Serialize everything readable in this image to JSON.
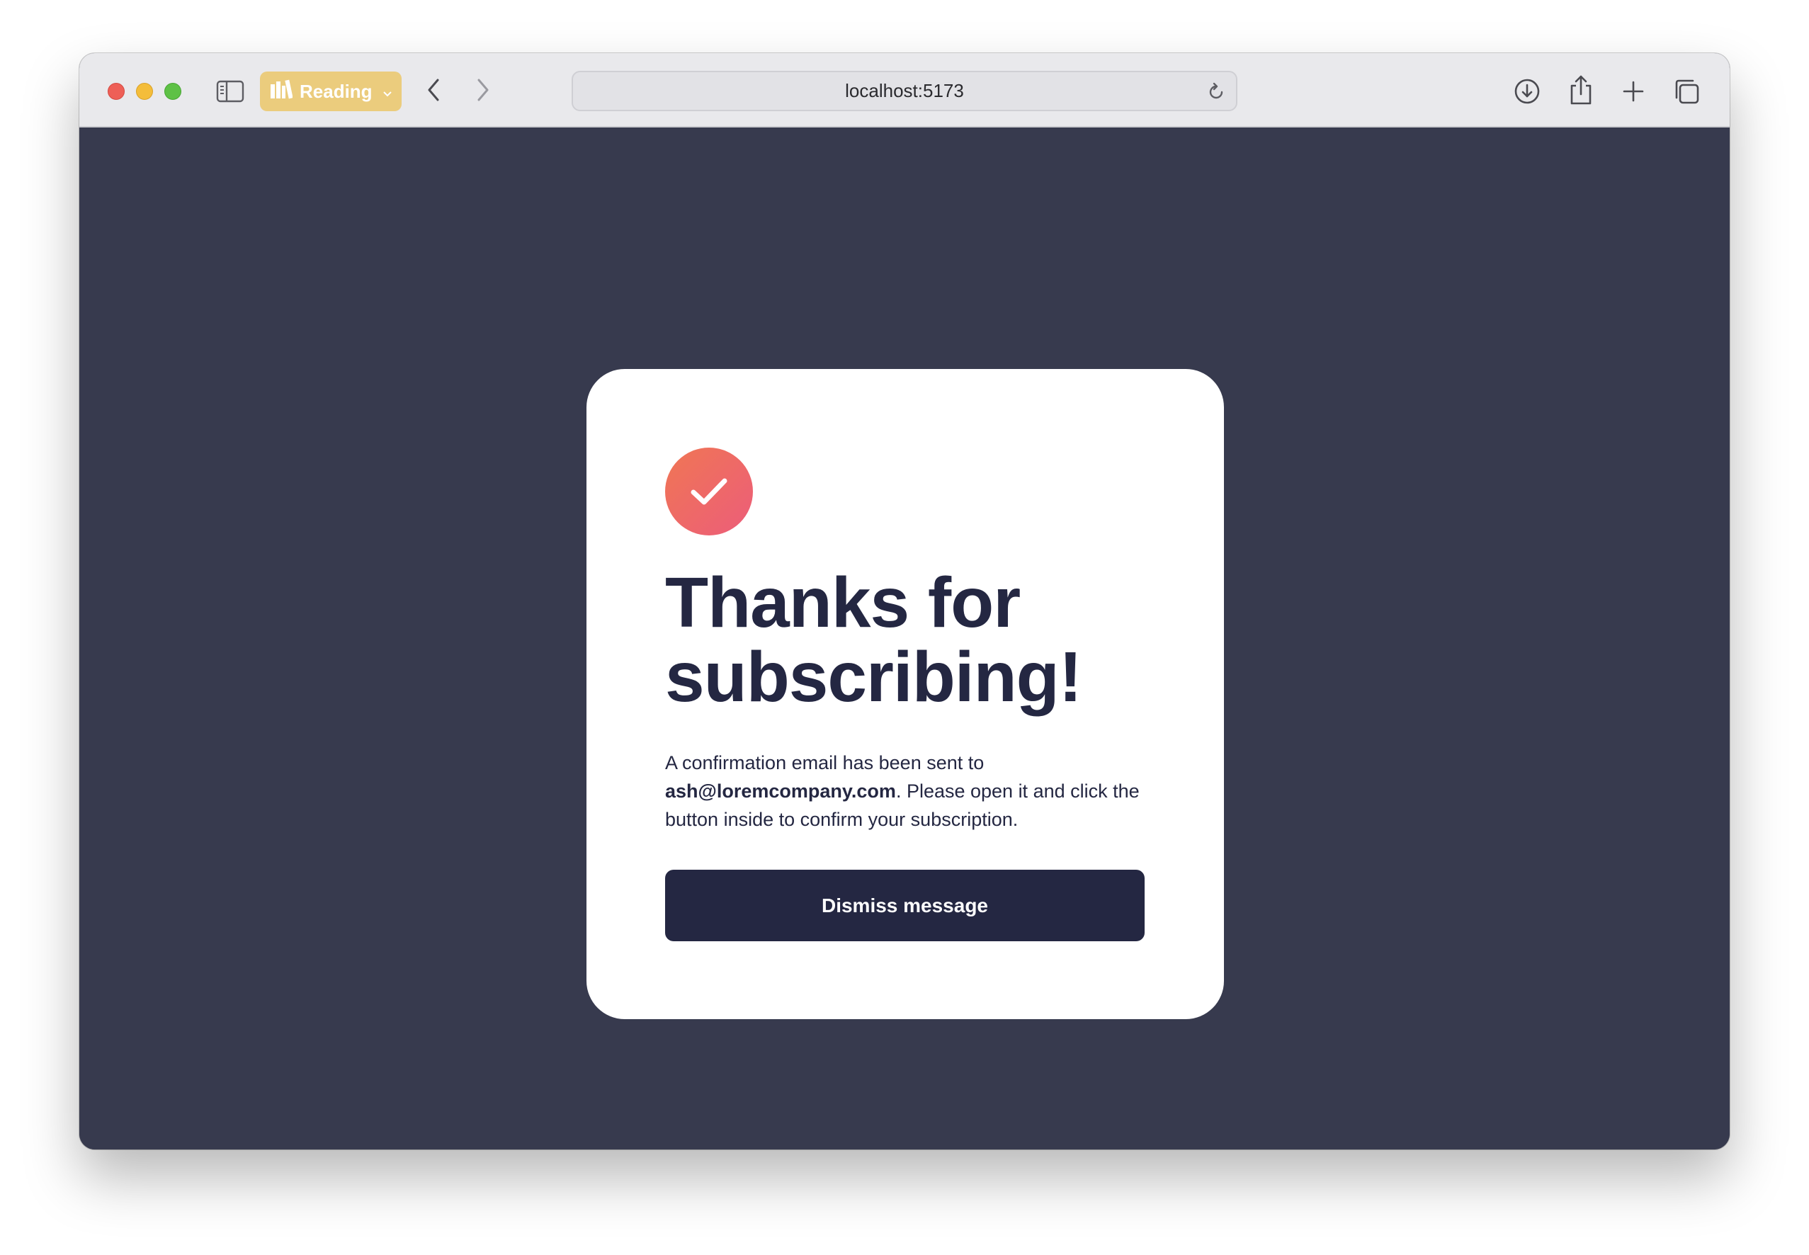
{
  "browser": {
    "reading_label": "Reading",
    "url": "localhost:5173",
    "colors": {
      "titlebar": "#e9e9ec",
      "reading_button": "#ebcc7d"
    },
    "icons": {
      "sidebar": "sidebar-icon",
      "reading": "reading-list-icon",
      "back": "chevron-left-icon",
      "forward": "chevron-right-icon",
      "reload": "reload-icon",
      "download": "download-icon",
      "share": "share-icon",
      "new_tab": "plus-icon",
      "tabs": "tabs-overview-icon"
    }
  },
  "page": {
    "background": "#373a4e",
    "card": {
      "icon": "checkmark-icon",
      "icon_gradient": [
        "#f07654",
        "#ec5d7a"
      ],
      "headline_line1": "Thanks for",
      "headline_line2": "subscribing!",
      "message_before": "A confirmation email has been sent to ",
      "email": "ash@loremcompany.com",
      "message_after": ". Please open it and click the button inside to confirm your subscription.",
      "button_label": "Dismiss message",
      "button_color": "#242742",
      "text_color": "#242742"
    }
  }
}
